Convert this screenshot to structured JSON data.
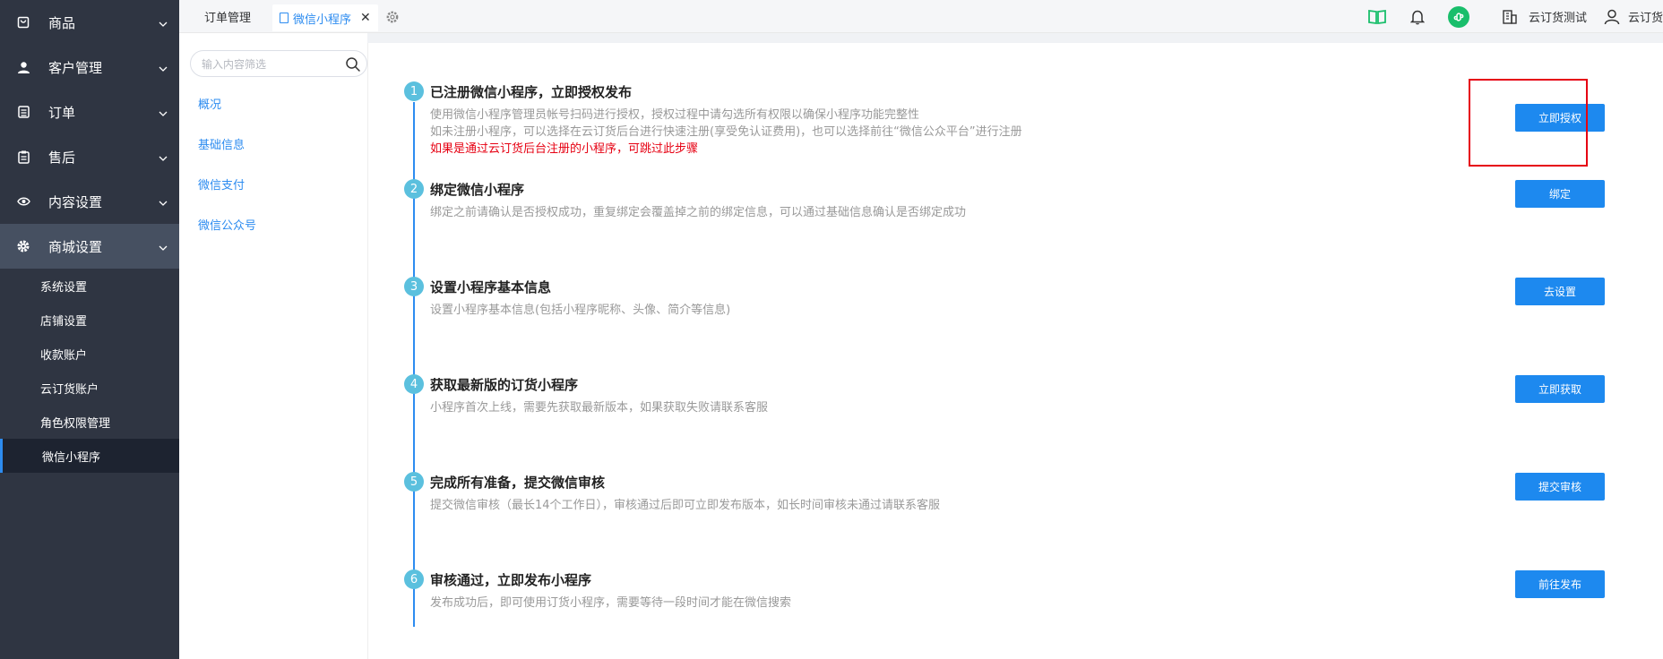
{
  "sidebar": {
    "menus": [
      {
        "label": "商品",
        "icon": "bag-icon"
      },
      {
        "label": "客户管理",
        "icon": "user-icon"
      },
      {
        "label": "订单",
        "icon": "order-icon"
      },
      {
        "label": "售后",
        "icon": "clipboard-icon"
      },
      {
        "label": "内容设置",
        "icon": "eye-icon"
      },
      {
        "label": "商城设置",
        "icon": "gear-icon"
      }
    ],
    "submenu": [
      "系统设置",
      "店铺设置",
      "收款账户",
      "云订货账户",
      "角色权限管理",
      "微信小程序"
    ],
    "active_sub": "微信小程序"
  },
  "topbar": {
    "tabs": [
      {
        "label": "订单管理"
      },
      {
        "label": "微信小程序",
        "close": "✕"
      }
    ],
    "account": "云订货测试",
    "user": "云订货"
  },
  "subnav": {
    "search_placeholder": "输入内容筛选",
    "links": [
      "概况",
      "基础信息",
      "微信支付",
      "微信公众号"
    ]
  },
  "steps": [
    {
      "num": "1",
      "title": "已注册微信小程序，立即授权发布",
      "desc": [
        "使用微信小程序管理员帐号扫码进行授权，授权过程中请勾选所有权限以确保小程序功能完整性",
        "如未注册小程序，可以选择在云订货后台进行快速注册(享受免认证费用)，也可以选择前往“微信公众平台”进行注册"
      ],
      "warn": "如果是通过云订货后台注册的小程序，可跳过此步骤",
      "button": "立即授权"
    },
    {
      "num": "2",
      "title": "绑定微信小程序",
      "desc": [
        "绑定之前请确认是否授权成功，重复绑定会覆盖掉之前的绑定信息，可以通过基础信息确认是否绑定成功"
      ],
      "button": "绑定"
    },
    {
      "num": "3",
      "title": "设置小程序基本信息",
      "desc": [
        "设置小程序基本信息(包括小程序昵称、头像、简介等信息)"
      ],
      "button": "去设置"
    },
    {
      "num": "4",
      "title": "获取最新版的订货小程序",
      "desc": [
        "小程序首次上线，需要先获取最新版本，如果获取失败请联系客服"
      ],
      "button": "立即获取"
    },
    {
      "num": "5",
      "title": "完成所有准备，提交微信审核",
      "desc": [
        "提交微信审核（最长14个工作日），审核通过后即可立即发布版本，如长时间审核未通过请联系客服"
      ],
      "button": "提交审核"
    },
    {
      "num": "6",
      "title": "审核通过，立即发布小程序",
      "desc": [
        "发布成功后，即可使用订货小程序，需要等待一段时间才能在微信搜索"
      ],
      "button": "前往发布"
    }
  ],
  "colors": {
    "primary": "#1d89ef",
    "sidebar": "#2f3542",
    "warn": "#e60012",
    "step_circle": "#5bc0de"
  }
}
